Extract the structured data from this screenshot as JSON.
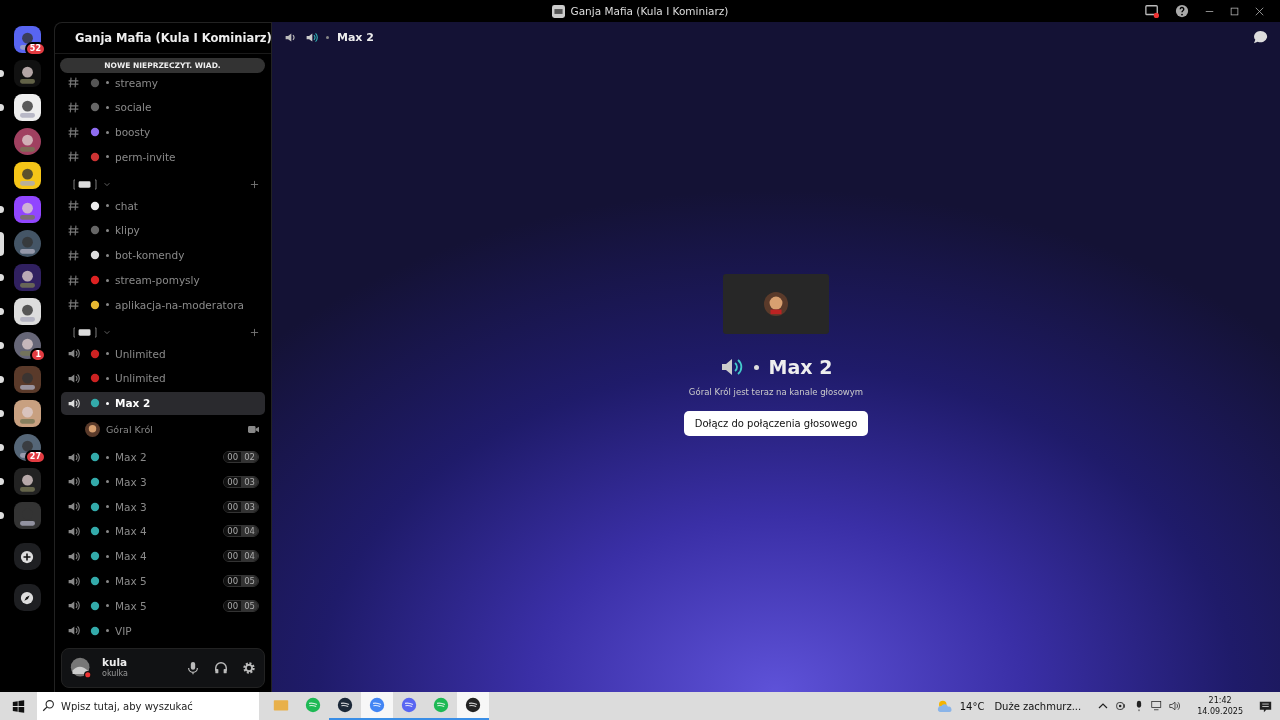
{
  "window": {
    "title": "Ganja Mafia (Kula I Kominiarz)"
  },
  "servers": [
    {
      "badge": "52",
      "unread": false,
      "selected": false
    },
    {
      "unread": true,
      "selected": false
    },
    {
      "unread": true,
      "selected": false
    },
    {
      "unread": false,
      "selected": false
    },
    {
      "unread": false,
      "selected": false
    },
    {
      "unread": true,
      "selected": false
    },
    {
      "unread": false,
      "selected": true
    },
    {
      "unread": true,
      "selected": false
    },
    {
      "unread": true,
      "selected": false
    },
    {
      "badge": "1",
      "unread": true,
      "selected": false
    },
    {
      "unread": true,
      "selected": false
    },
    {
      "unread": true,
      "selected": false
    },
    {
      "badge": "27",
      "unread": true,
      "selected": false
    },
    {
      "unread": true,
      "selected": false
    },
    {
      "unread": true,
      "selected": false
    }
  ],
  "server_header": {
    "name": "Ganja Mafia (Kula I Kominiarz)"
  },
  "unread_banner": "NOWE NIEPRZECZYT. WIAD.",
  "channels": [
    {
      "kind": "text",
      "name": "streamy",
      "selected": false
    },
    {
      "kind": "text",
      "name": "sociale",
      "selected": false
    },
    {
      "kind": "text",
      "name": "boosty",
      "selected": false
    },
    {
      "kind": "text",
      "name": "perm-invite",
      "selected": false
    },
    {
      "kind": "category"
    },
    {
      "kind": "text",
      "name": "chat",
      "selected": false
    },
    {
      "kind": "text",
      "name": "klipy",
      "selected": false
    },
    {
      "kind": "text",
      "name": "bot-komendy",
      "selected": false
    },
    {
      "kind": "text",
      "name": "stream-pomysly",
      "selected": false
    },
    {
      "kind": "text",
      "name": "aplikacja-na-moderatora",
      "selected": false
    },
    {
      "kind": "category"
    },
    {
      "kind": "voice",
      "name": "Unlimited",
      "selected": false
    },
    {
      "kind": "voice",
      "name": "Unlimited",
      "selected": false
    },
    {
      "kind": "voice",
      "name": "Max 2",
      "selected": true,
      "users": [
        {
          "name": "Góral Król",
          "video": true
        }
      ]
    },
    {
      "kind": "voice",
      "name": "Max 2",
      "selected": false,
      "count": "00",
      "limit": "02"
    },
    {
      "kind": "voice",
      "name": "Max 3",
      "selected": false,
      "count": "00",
      "limit": "03"
    },
    {
      "kind": "voice",
      "name": "Max 3",
      "selected": false,
      "count": "00",
      "limit": "03"
    },
    {
      "kind": "voice",
      "name": "Max 4",
      "selected": false,
      "count": "00",
      "limit": "04"
    },
    {
      "kind": "voice",
      "name": "Max 4",
      "selected": false,
      "count": "00",
      "limit": "04"
    },
    {
      "kind": "voice",
      "name": "Max 5",
      "selected": false,
      "count": "00",
      "limit": "05"
    },
    {
      "kind": "voice",
      "name": "Max 5",
      "selected": false,
      "count": "00",
      "limit": "05"
    },
    {
      "kind": "voice",
      "name": "VIP",
      "selected": false
    }
  ],
  "user_panel": {
    "name": "kula",
    "status_text": "okulka"
  },
  "main": {
    "channel_title": "Max 2",
    "heading": "Max 2",
    "subtitle": "Góral Król jest teraz na kanale głosowym",
    "join_button": "Dołącz do połączenia głosowego"
  },
  "taskbar": {
    "search": {
      "placeholder": "Wpisz tutaj, aby wyszukać"
    },
    "apps": [
      {
        "running": false,
        "selected": false
      },
      {
        "running": false,
        "selected": false
      },
      {
        "running": true,
        "selected": false
      },
      {
        "running": true,
        "selected": true
      },
      {
        "running": true,
        "selected": false
      },
      {
        "running": true,
        "selected": false
      },
      {
        "running": true,
        "selected": true
      }
    ],
    "weather": {
      "temperature": "14°C",
      "condition": "Duże zachmurz..."
    },
    "time": "21:42",
    "date": "14.09.2025"
  }
}
